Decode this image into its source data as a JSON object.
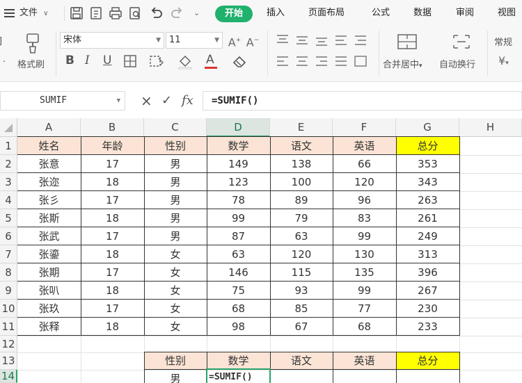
{
  "menu": {
    "hamburger_icon": "hamburger-icon",
    "file_label": "文件",
    "tabs": [
      "开始",
      "插入",
      "页面布局",
      "公式",
      "数据",
      "审阅",
      "视图"
    ]
  },
  "ribbon": {
    "font_name": "宋体",
    "font_size": "11",
    "format_painter_label": "格式刷",
    "merge_center_label": "合并居中",
    "wrap_text_label": "自动换行",
    "number_format_label": "常规",
    "bold_label": "B",
    "currency_label": "¥"
  },
  "formula_bar": {
    "name_box": "SUMIF",
    "cancel_symbol": "×",
    "confirm_symbol": "✓",
    "fx_label": "fx",
    "formula": "=SUMIF()"
  },
  "sheet": {
    "columns": [
      "A",
      "B",
      "C",
      "D",
      "E",
      "F",
      "G",
      "H"
    ],
    "rows": [
      "1",
      "2",
      "3",
      "4",
      "5",
      "6",
      "7",
      "8",
      "9",
      "10",
      "11",
      "12",
      "13",
      "14"
    ],
    "headers": [
      "姓名",
      "年龄",
      "性别",
      "数学",
      "语文",
      "英语",
      "总分"
    ],
    "data": [
      [
        "张意",
        "17",
        "男",
        "149",
        "138",
        "66",
        "353"
      ],
      [
        "张迩",
        "18",
        "男",
        "123",
        "100",
        "120",
        "343"
      ],
      [
        "张彡",
        "17",
        "男",
        "78",
        "89",
        "96",
        "263"
      ],
      [
        "张斯",
        "18",
        "男",
        "99",
        "79",
        "83",
        "261"
      ],
      [
        "张武",
        "17",
        "男",
        "87",
        "63",
        "99",
        "249"
      ],
      [
        "张鎏",
        "18",
        "女",
        "63",
        "120",
        "130",
        "313"
      ],
      [
        "张期",
        "17",
        "女",
        "146",
        "115",
        "135",
        "396"
      ],
      [
        "张叭",
        "18",
        "女",
        "75",
        "93",
        "99",
        "267"
      ],
      [
        "张玖",
        "17",
        "女",
        "68",
        "85",
        "77",
        "230"
      ],
      [
        "张释",
        "18",
        "女",
        "98",
        "67",
        "68",
        "233"
      ]
    ],
    "summary_headers": [
      "性别",
      "数学",
      "语文",
      "英语",
      "总分"
    ],
    "summary_row": [
      "男",
      "=SUMIF()",
      "",
      "",
      ""
    ]
  },
  "colors": {
    "accent": "#20b16d",
    "header_fill": "#fbe4d5",
    "total_fill": "#ffff00",
    "active_cell_border": "#2aa36b"
  }
}
